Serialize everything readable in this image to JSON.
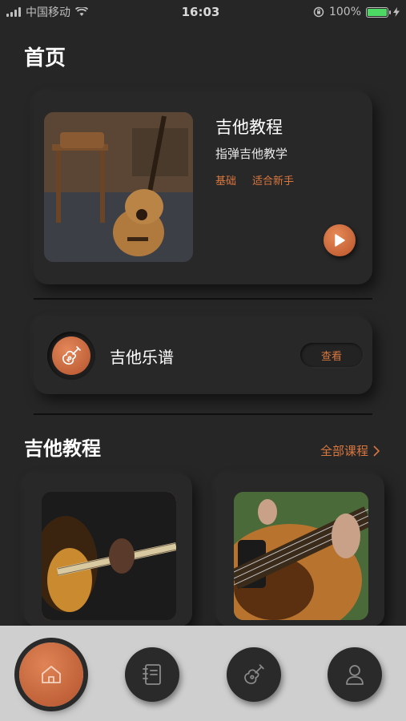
{
  "status_bar": {
    "carrier": "中国移动",
    "time": "16:03",
    "battery_percent": "100%",
    "battery_level": 1.0
  },
  "page": {
    "title": "首页"
  },
  "hero": {
    "title": "吉他教程",
    "subtitle": "指弹吉他教学",
    "tags": [
      "基础",
      "适合新手"
    ]
  },
  "sheet_music": {
    "title": "吉他乐谱",
    "view_label": "查看"
  },
  "courses": {
    "section_title": "吉他教程",
    "see_all_label": "全部课程"
  },
  "tabbar": {
    "items": [
      {
        "icon": "home-icon",
        "active": true
      },
      {
        "icon": "notebook-icon",
        "active": false
      },
      {
        "icon": "guitar-icon",
        "active": false
      },
      {
        "icon": "user-icon",
        "active": false
      }
    ]
  },
  "colors": {
    "accent": "#d9773f",
    "background": "#262626",
    "tabbar": "#cfcfcf"
  }
}
